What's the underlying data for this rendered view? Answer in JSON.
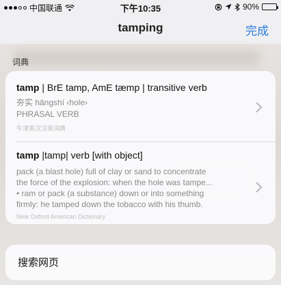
{
  "status_bar": {
    "carrier": "中国联通",
    "time": "下午10:35",
    "battery_percent": "90%",
    "battery_level": 0.9
  },
  "nav": {
    "title": "tamping",
    "done_label": "完成"
  },
  "section_label": "词典",
  "entries": [
    {
      "word": "tamp",
      "headline_rest": " | BrE tamp, AmE tæmp | transitive verb",
      "lines": [
        "夯实 hāngshí ‹hole›",
        "PHRASAL VERB"
      ],
      "source": "牛津英汉汉英词典"
    },
    {
      "word": "tamp",
      "headline_rest": " |tamp| verb [with object]",
      "lines": [
        "pack (a blast hole) full of clay or sand to concentrate",
        "the force of the explosion: when the hole was tampe...",
        "• ram or pack (a substance) down or into something",
        "firmly: he tamped down the tobacco with his thumb."
      ],
      "source": "New Oxford American Dictionary"
    }
  ],
  "search_web_label": "搜索网页",
  "colors": {
    "accent": "#2b7bdc",
    "background": "#f0f0f2"
  }
}
